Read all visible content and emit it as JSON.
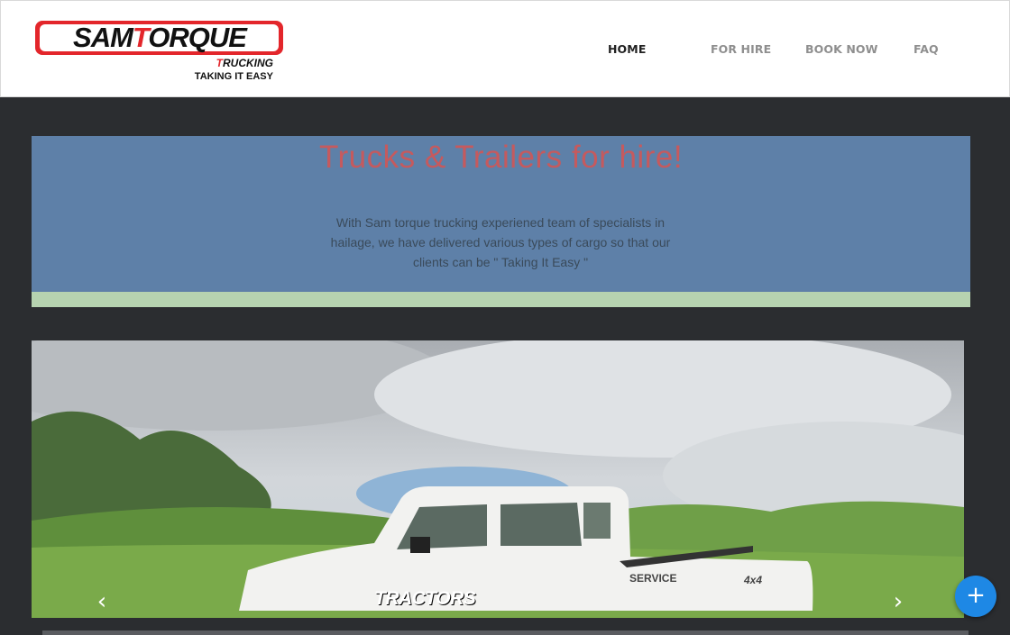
{
  "brand": {
    "name": "SAMTORQUE",
    "sub": "TRUCKING",
    "tagline": "TAKING IT EASY"
  },
  "nav": {
    "items": [
      {
        "label": "HOME",
        "active": true
      },
      {
        "label": "FOR HIRE",
        "active": false
      },
      {
        "label": "BOOK NOW",
        "active": false
      },
      {
        "label": "FAQ",
        "active": false
      }
    ]
  },
  "hero": {
    "title": "Trucks & Trailers for hire!",
    "description": "With Sam torque trucking experiened team of specialists in hailage, we have delivered various types of cargo so that our clients can be \" Taking It Easy \""
  },
  "carousel": {
    "prev_glyph": "‹",
    "next_glyph": "›",
    "vehicle_label": "TRACTORS",
    "vehicle_side_text": "SERVICE",
    "vehicle_badge": "4x4"
  },
  "fab": {
    "glyph": "+"
  },
  "colors": {
    "hero_bg": "#5e80a8",
    "hero_title": "#c55a5e",
    "hero_strip": "#b6d3b0",
    "page_bg": "#2b2d30",
    "fab": "#1e88e5",
    "logo_red": "#e3262b"
  }
}
